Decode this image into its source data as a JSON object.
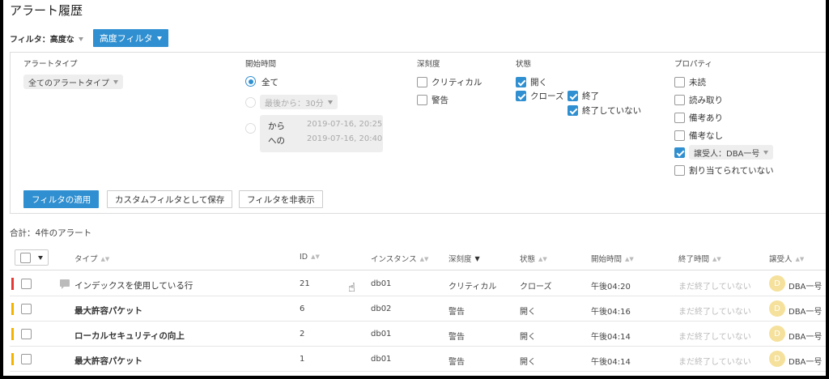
{
  "page": {
    "title": "アラート履歴"
  },
  "filter_bar": {
    "label": "フィルタ：高度な",
    "advanced_button": "高度フィルタ"
  },
  "panel": {
    "alert_type": {
      "heading": "アラートタイプ",
      "value": "全てのアラートタイプ"
    },
    "start_time": {
      "heading": "開始時間",
      "all_label": "全て",
      "last_label": "最後から：30分",
      "from_label": "から",
      "to_label": "への",
      "from_value": "2019-07-16, 20:25",
      "to_value": "2019-07-16, 20:40",
      "selected": "all"
    },
    "severity": {
      "heading": "深刻度",
      "options": [
        {
          "label": "クリティカル",
          "checked": false
        },
        {
          "label": "警告",
          "checked": false
        }
      ]
    },
    "status": {
      "heading": "状態",
      "open": {
        "label": "開く",
        "checked": true
      },
      "closed": {
        "label": "クローズ",
        "checked": true
      },
      "ended": {
        "label": "終了",
        "checked": true
      },
      "not_ended": {
        "label": "終了していない",
        "checked": true
      }
    },
    "property": {
      "heading": "プロパティ",
      "unread": {
        "label": "未読",
        "checked": false
      },
      "read": {
        "label": "読み取り",
        "checked": false
      },
      "has_note": {
        "label": "備考あり",
        "checked": false
      },
      "no_note": {
        "label": "備考なし",
        "checked": false
      },
      "assignee": {
        "label": "譲受人：DBA一号",
        "checked": true
      },
      "unassigned": {
        "label": "割り当てられていない",
        "checked": false
      }
    },
    "buttons": {
      "apply": "フィルタの適用",
      "save": "カスタムフィルタとして保存",
      "hide": "フィルタを非表示"
    }
  },
  "summary": {
    "total": "合計：4件のアラート"
  },
  "table": {
    "columns": {
      "type": "タイプ",
      "id": "ID",
      "instance": "インスタンス",
      "severity": "深刻度",
      "status": "状態",
      "start": "開始時間",
      "end": "終了時間",
      "assignee": "譲受人"
    },
    "sort_column": "severity",
    "rows": [
      {
        "severity_color": "#e53935",
        "name": "インデックスを使用している行",
        "bold": false,
        "comment": true,
        "id": "21",
        "instance": "db01",
        "severity": "クリティカル",
        "status": "クローズ",
        "start": "午後04:20",
        "end": "まだ終了していない",
        "avatar": "D",
        "assignee": "DBA一号"
      },
      {
        "severity_color": "#f2b400",
        "name": "最大許容パケット",
        "bold": true,
        "comment": false,
        "id": "6",
        "instance": "db02",
        "severity": "警告",
        "status": "開く",
        "start": "午後04:16",
        "end": "まだ終了していない",
        "avatar": "D",
        "assignee": "DBA一号"
      },
      {
        "severity_color": "#f2b400",
        "name": "ローカルセキュリティの向上",
        "bold": true,
        "comment": false,
        "id": "2",
        "instance": "db01",
        "severity": "警告",
        "status": "開く",
        "start": "午後04:14",
        "end": "まだ終了していない",
        "avatar": "D",
        "assignee": "DBA一号"
      },
      {
        "severity_color": "#f2b400",
        "name": "最大許容パケット",
        "bold": true,
        "comment": false,
        "id": "1",
        "instance": "db01",
        "severity": "警告",
        "status": "開く",
        "start": "午後04:14",
        "end": "まだ終了していない",
        "avatar": "D",
        "assignee": "DBA一号"
      }
    ]
  },
  "colors": {
    "accent": "#2f8fd0",
    "critical": "#e53935",
    "warning": "#f2b400",
    "avatar": "#f5e19c"
  },
  "icons": {
    "comment": "comment-icon",
    "cursor": "hand-pointer-icon",
    "sort": "sort-arrows-icon"
  }
}
